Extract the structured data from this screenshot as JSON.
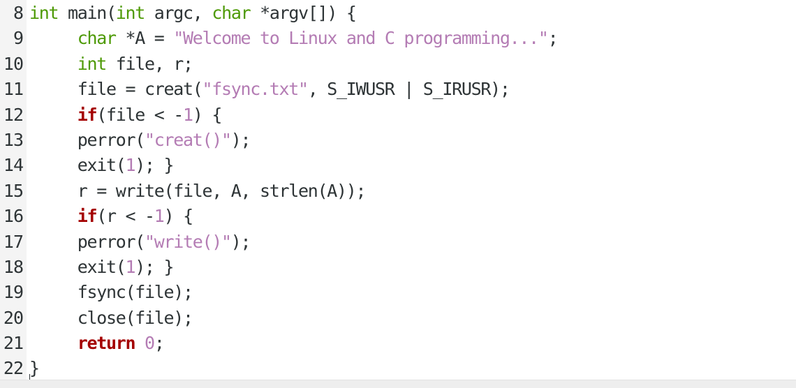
{
  "editor": {
    "language": "c",
    "colors": {
      "type_keyword": "#4e9a06",
      "control_keyword": "#a40000",
      "string_literal": "#b47cb4",
      "number_literal": "#b47cb4",
      "text": "#2e3436",
      "gutter_bg": "#f4f4f4"
    },
    "lines": [
      {
        "number": "8",
        "tokens": [
          {
            "t": "type",
            "v": "int"
          },
          {
            "t": "plain",
            "v": " main("
          },
          {
            "t": "type",
            "v": "int"
          },
          {
            "t": "plain",
            "v": " argc, "
          },
          {
            "t": "type",
            "v": "char"
          },
          {
            "t": "plain",
            "v": " *argv[]) {"
          }
        ]
      },
      {
        "number": "9",
        "tokens": [
          {
            "t": "plain",
            "v": "     "
          },
          {
            "t": "type",
            "v": "char"
          },
          {
            "t": "plain",
            "v": " *A = "
          },
          {
            "t": "str",
            "v": "\"Welcome to Linux and C programming...\""
          },
          {
            "t": "plain",
            "v": ";"
          }
        ]
      },
      {
        "number": "10",
        "tokens": [
          {
            "t": "plain",
            "v": "     "
          },
          {
            "t": "type",
            "v": "int"
          },
          {
            "t": "plain",
            "v": " file, r;"
          }
        ]
      },
      {
        "number": "11",
        "tokens": [
          {
            "t": "plain",
            "v": "     file = creat("
          },
          {
            "t": "str",
            "v": "\"fsync.txt\""
          },
          {
            "t": "plain",
            "v": ", S_IWUSR | S_IRUSR);"
          }
        ]
      },
      {
        "number": "12",
        "tokens": [
          {
            "t": "plain",
            "v": "     "
          },
          {
            "t": "ctrl",
            "v": "if"
          },
          {
            "t": "plain",
            "v": "(file < -"
          },
          {
            "t": "num",
            "v": "1"
          },
          {
            "t": "plain",
            "v": ") {"
          }
        ]
      },
      {
        "number": "13",
        "tokens": [
          {
            "t": "plain",
            "v": "     perror("
          },
          {
            "t": "str",
            "v": "\"creat()\""
          },
          {
            "t": "plain",
            "v": ");"
          }
        ]
      },
      {
        "number": "14",
        "tokens": [
          {
            "t": "plain",
            "v": "     exit("
          },
          {
            "t": "num",
            "v": "1"
          },
          {
            "t": "plain",
            "v": "); }"
          }
        ]
      },
      {
        "number": "15",
        "tokens": [
          {
            "t": "plain",
            "v": "     r = write(file, A, strlen(A));"
          }
        ]
      },
      {
        "number": "16",
        "tokens": [
          {
            "t": "plain",
            "v": "     "
          },
          {
            "t": "ctrl",
            "v": "if"
          },
          {
            "t": "plain",
            "v": "(r < -"
          },
          {
            "t": "num",
            "v": "1"
          },
          {
            "t": "plain",
            "v": ") {"
          }
        ]
      },
      {
        "number": "17",
        "tokens": [
          {
            "t": "plain",
            "v": "     perror("
          },
          {
            "t": "str",
            "v": "\"write()\""
          },
          {
            "t": "plain",
            "v": ");"
          }
        ]
      },
      {
        "number": "18",
        "tokens": [
          {
            "t": "plain",
            "v": "     exit("
          },
          {
            "t": "num",
            "v": "1"
          },
          {
            "t": "plain",
            "v": "); }"
          }
        ]
      },
      {
        "number": "19",
        "tokens": [
          {
            "t": "plain",
            "v": "     fsync(file);"
          }
        ]
      },
      {
        "number": "20",
        "tokens": [
          {
            "t": "plain",
            "v": "     close(file);"
          }
        ]
      },
      {
        "number": "21",
        "tokens": [
          {
            "t": "plain",
            "v": "     "
          },
          {
            "t": "ctrl",
            "v": "return"
          },
          {
            "t": "plain",
            "v": " "
          },
          {
            "t": "num",
            "v": "0"
          },
          {
            "t": "plain",
            "v": ";"
          }
        ]
      },
      {
        "number": "22",
        "tokens": [
          {
            "t": "plain",
            "v": "}"
          }
        ]
      }
    ]
  }
}
